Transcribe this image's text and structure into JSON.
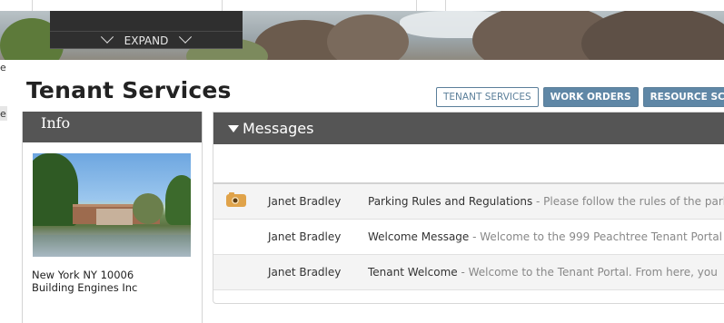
{
  "banner": {
    "expand_label": "EXPAND"
  },
  "edge": {
    "cut_text_1": "e",
    "cut_text_2": "e"
  },
  "page": {
    "title": "Tenant Services"
  },
  "tabs": [
    {
      "label": "TENANT SERVICES",
      "active": true
    },
    {
      "label": "WORK ORDERS",
      "active": false
    },
    {
      "label": "RESOURCE SCH",
      "active": false
    }
  ],
  "info": {
    "header": "Info",
    "address_line_1": "New York NY 10006",
    "address_line_2": "Building Engines Inc"
  },
  "messages": {
    "header": "Messages",
    "rows": [
      {
        "icon": "camera-icon",
        "author": "Janet Bradley",
        "subject": "Parking Rules and Regulations",
        "preview": " - Please follow the rules of the parki"
      },
      {
        "icon": "",
        "author": "Janet Bradley",
        "subject": "Welcome Message",
        "preview": " - Welcome to the 999 Peachtree Tenant Portal"
      },
      {
        "icon": "",
        "author": "Janet Bradley",
        "subject": "Tenant Welcome",
        "preview": " - Welcome to the Tenant Portal. From here, you"
      }
    ]
  },
  "colors": {
    "panel_header": "#555555",
    "tab_active_border": "#5b7f9a",
    "tab_inactive_bg": "#5f87a6",
    "camera_icon": "#e0a34a"
  }
}
